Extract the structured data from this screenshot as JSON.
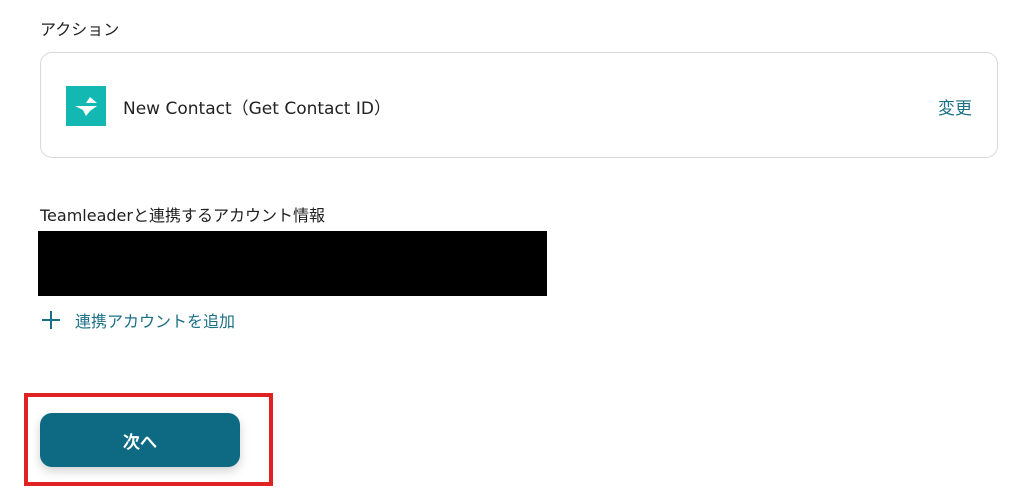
{
  "action_section": {
    "label": "アクション",
    "app_icon": "teamleader-logo-icon",
    "action_name": "New Contact（Get Contact ID）",
    "change_label": "変更"
  },
  "account_section": {
    "label": "Teamleaderと連携するアカウント情報",
    "add_account_label": "連携アカウントを追加",
    "add_icon": "plus-icon"
  },
  "footer": {
    "next_label": "次へ"
  },
  "colors": {
    "accent": "#1b6f86",
    "button": "#0e6a82",
    "app_icon_bg": "#14b8b2",
    "highlight": "#e02222"
  }
}
